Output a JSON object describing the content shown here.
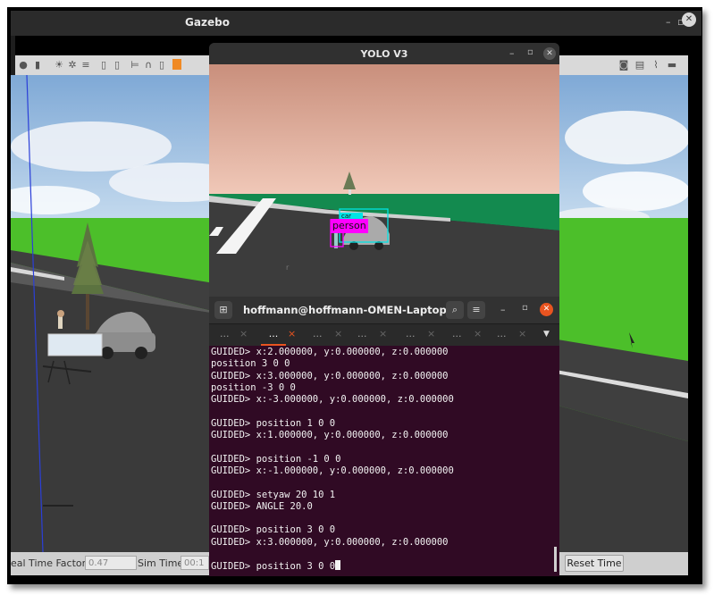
{
  "gazebo": {
    "title": "Gazebo",
    "minimize": "–",
    "maximize": "▫",
    "close": "✕",
    "bottom": {
      "rtf_label": "eal Time Factor:",
      "rtf_value": "0.47",
      "sim_label": "Sim Time:",
      "sim_value": "00:1",
      "reset_label": "Reset Time"
    }
  },
  "yolo": {
    "title": "YOLO V3",
    "detections": [
      {
        "label": "car",
        "color": "#00e5e5"
      },
      {
        "label": "person",
        "color": "#ff00ff"
      }
    ]
  },
  "terminal": {
    "title": "hoffmann@hoffmann-OMEN-Laptop-...",
    "tabs": [
      "...",
      "...",
      "...",
      "...",
      "...",
      "...",
      "..."
    ],
    "lines": [
      "GUIDED> x:2.000000, y:0.000000, z:0.000000",
      "position 3 0 0",
      "GUIDED> x:3.000000, y:0.000000, z:0.000000",
      "position -3 0 0",
      "GUIDED> x:-3.000000, y:0.000000, z:0.000000",
      "",
      "GUIDED> position 1 0 0",
      "GUIDED> x:1.000000, y:0.000000, z:0.000000",
      "",
      "GUIDED> position -1 0 0",
      "GUIDED> x:-1.000000, y:0.000000, z:0.000000",
      "",
      "GUIDED> setyaw 20 10 1",
      "GUIDED> ANGLE 20.0",
      "",
      "GUIDED> position 3 0 0",
      "GUIDED> x:3.000000, y:0.000000, z:0.000000",
      ""
    ],
    "prompt_line": "GUIDED> position 3 0 0"
  },
  "colors": {
    "terminal_bg": "#300a24",
    "accent": "#e95420",
    "grass": "#4cbf2a",
    "road": "#3d3d3d"
  }
}
